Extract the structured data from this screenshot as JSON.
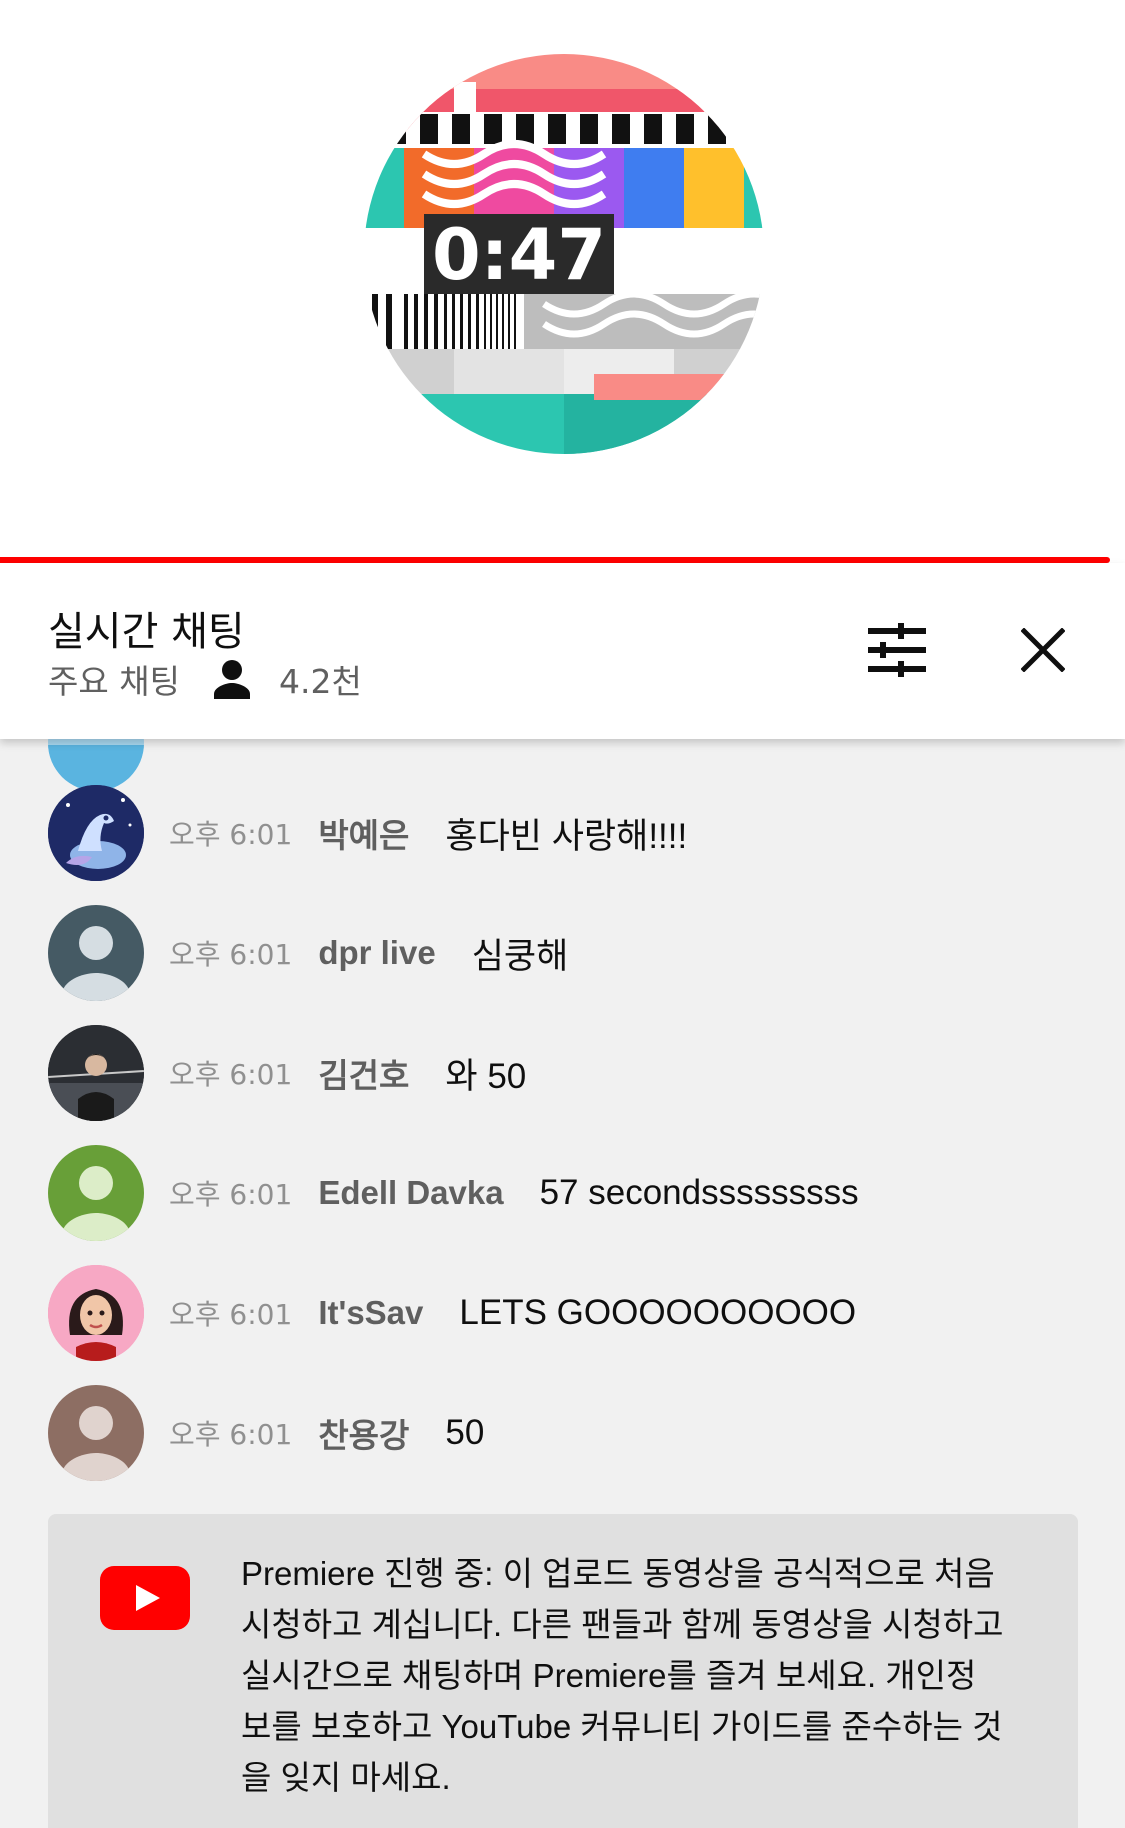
{
  "video": {
    "countdown": "0:47"
  },
  "chat_header": {
    "title": "실시간 채팅",
    "mode": "주요 채팅",
    "viewer_count": "4.2천",
    "icons": {
      "viewer": "person-icon",
      "filter": "tune-icon",
      "close": "close-icon"
    }
  },
  "messages": [
    {
      "time": "오후 6:01",
      "author": "박예은",
      "text": "홍다빈 사랑해!!!!",
      "avatar": "character-avatar"
    },
    {
      "time": "오후 6:01",
      "author": "dpr live",
      "text": "심쿵해",
      "avatar": "default-avatar"
    },
    {
      "time": "오후 6:01",
      "author": "김건호",
      "text": "와 50",
      "avatar": "photo-avatar"
    },
    {
      "time": "오후 6:01",
      "author": "Edell Davka",
      "text": "57 secondsssssssss",
      "avatar": "default-avatar"
    },
    {
      "time": "오후 6:01",
      "author": "It'sSav",
      "text": "LETS GOOOOOOOOOO",
      "avatar": "memoji-avatar"
    },
    {
      "time": "오후 6:01",
      "author": "찬용강",
      "text": "50",
      "avatar": "default-avatar"
    }
  ],
  "notice": {
    "lines": [
      "Premiere 진행 중: 이 업로드 동영상을 공식적으로 처음",
      "시청하고 계십니다. 다른 팬들과 함께 동영상을 시청하고",
      "실시간으로 채팅하며 Premiere를 즐겨 보세요. 개인정",
      "보를 보호하고 YouTube 커뮤니티 가이드를 준수하는 것",
      "을 잊지 마세요."
    ],
    "icon": "youtube-logo-icon"
  },
  "colors": {
    "accent_red": "#ff0000",
    "chat_bg": "#f1f1f1",
    "notice_bg": "#e0e0e0",
    "avatar_slate": "#455a64",
    "avatar_green": "#689f38",
    "avatar_brown": "#8d6e63",
    "avatar_pink": "#f48fb1"
  }
}
